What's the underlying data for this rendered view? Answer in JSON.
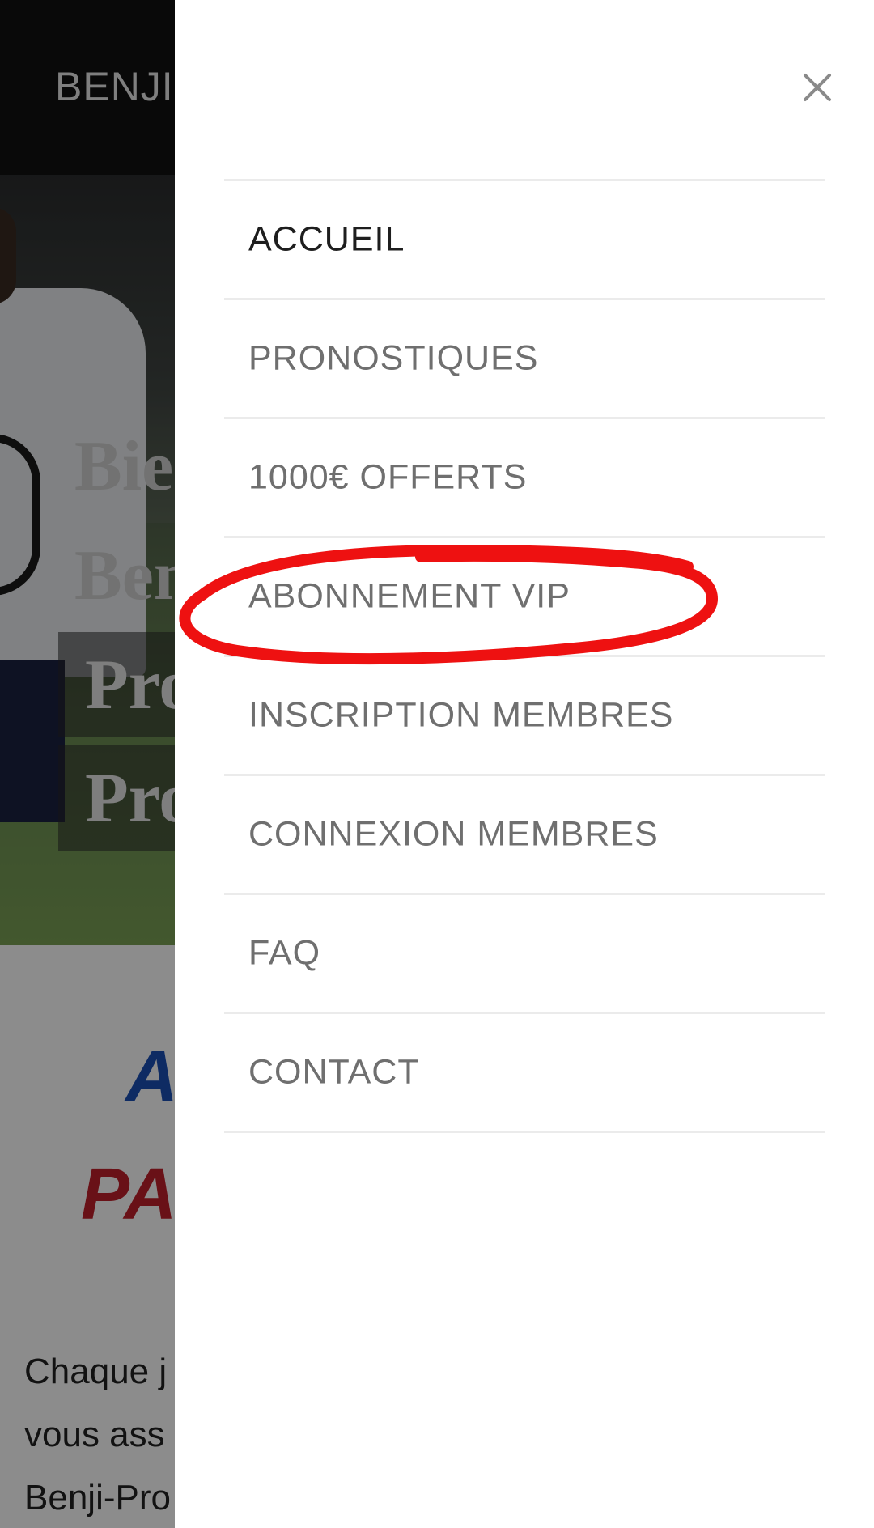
{
  "background_page": {
    "brand_title": "BENJI-",
    "hero_lines": [
      "Bie",
      "Ben",
      "Pro",
      "Pro"
    ],
    "heading_line1": "A",
    "heading_line2": "PA",
    "paragraph_lines": [
      "Chaque j",
      "vous ass",
      "Benji-Pro"
    ]
  },
  "drawer": {
    "close_glyph": "×",
    "menu_items": [
      {
        "label": "ACCUEIL",
        "active": true
      },
      {
        "label": "PRONOSTIQUES",
        "active": false
      },
      {
        "label": "1000€ OFFERTS",
        "active": false
      },
      {
        "label": "ABONNEMENT VIP",
        "active": false
      },
      {
        "label": "INSCRIPTION MEMBRES",
        "active": false
      },
      {
        "label": "CONNEXION MEMBRES",
        "active": false
      },
      {
        "label": "FAQ",
        "active": false
      },
      {
        "label": "CONTACT",
        "active": false
      }
    ]
  },
  "annotation": {
    "type": "red-freehand-ellipse",
    "highlights": "ABONNEMENT VIP",
    "color": "#ee1111"
  },
  "colors": {
    "menu_text": "#6f6f6f",
    "menu_text_active": "#1e1e1e",
    "divider": "#ebebeb",
    "overlay": "rgba(0,0,0,0.45)"
  }
}
